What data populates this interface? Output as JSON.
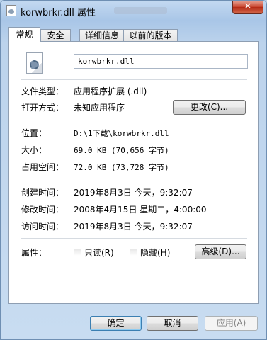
{
  "window": {
    "title": "korwbrkr.dll 属性",
    "close_glyph": "✕"
  },
  "tabs": [
    {
      "label": "常规",
      "active": true
    },
    {
      "label": "安全",
      "active": false
    },
    {
      "label": "详细信息",
      "active": false
    },
    {
      "label": "以前的版本",
      "active": false
    }
  ],
  "general": {
    "file_name": "korwbrkr.dll",
    "file_type_label": "文件类型：",
    "file_type_value": "应用程序扩展 (.dll)",
    "opens_with_label": "打开方式：",
    "opens_with_value": "未知应用程序",
    "change_button": "更改(C)...",
    "location_label": "位置：",
    "location_value": "D:\\1下载\\korwbrkr.dll",
    "size_label": "大小：",
    "size_value": "69.0 KB (70,656 字节)",
    "size_on_disk_label": "占用空间：",
    "size_on_disk_value": "72.0 KB (73,728 字节)",
    "created_label": "创建时间：",
    "created_value": "2019年8月3日 今天，9:32:07",
    "modified_label": "修改时间：",
    "modified_value": "2008年4月15日 星期二，4:00:00",
    "accessed_label": "访问时间：",
    "accessed_value": "2019年8月3日 今天，9:32:07",
    "attributes_label": "属性：",
    "readonly_label": "只读(R)",
    "hidden_label": "隐藏(H)",
    "advanced_button": "高级(D)...",
    "readonly_checked": false,
    "hidden_checked": false
  },
  "footer": {
    "ok_button": "确定",
    "cancel_button": "取消",
    "apply_button": "应用(A)"
  }
}
